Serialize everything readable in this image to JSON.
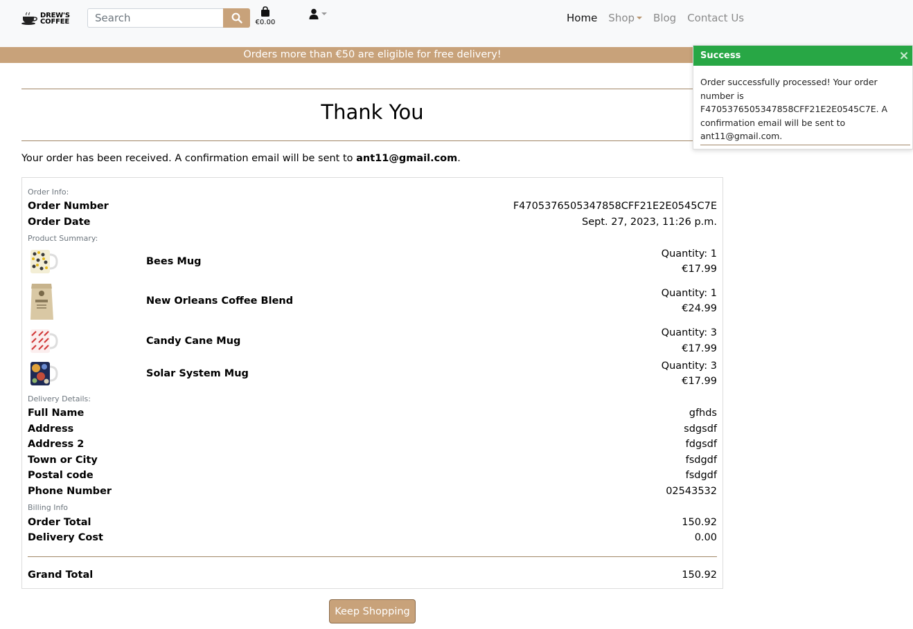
{
  "header": {
    "logo_line1": "DREW'S",
    "logo_line2": "COFFEE",
    "search_placeholder": "Search",
    "bag_total": "€0.00",
    "nav": [
      {
        "label": "Home",
        "active": true
      },
      {
        "label": "Shop",
        "dropdown": true
      },
      {
        "label": "Blog"
      },
      {
        "label": "Contact Us"
      }
    ]
  },
  "banner": {
    "text": "Orders more than €50 are eligible for free delivery!"
  },
  "page": {
    "title": "Thank You",
    "intro_prefix": "Your order has been received. A confirmation email will be sent to ",
    "email": "ant11@gmail.com",
    "intro_suffix": "."
  },
  "order_info": {
    "section_label": "Order Info:",
    "order_number_label": "Order Number",
    "order_number": "F4705376505347858CFF21E2E0545C7E",
    "order_date_label": "Order Date",
    "order_date": "Sept. 27, 2023, 11:26 p.m."
  },
  "products": {
    "section_label": "Product Summary:",
    "items": [
      {
        "name": "Bees Mug",
        "quantity": "Quantity: 1",
        "price": "€17.99"
      },
      {
        "name": "New Orleans Coffee Blend",
        "quantity": "Quantity: 1",
        "price": "€24.99"
      },
      {
        "name": "Candy Cane Mug",
        "quantity": "Quantity: 3",
        "price": "€17.99"
      },
      {
        "name": "Solar System Mug",
        "quantity": "Quantity: 3",
        "price": "€17.99"
      }
    ]
  },
  "delivery": {
    "section_label": "Delivery Details:",
    "rows": [
      {
        "label": "Full Name",
        "value": "gfhds"
      },
      {
        "label": "Address",
        "value": "sdgsdf"
      },
      {
        "label": "Address 2",
        "value": "fdgsdf"
      },
      {
        "label": "Town or City",
        "value": "fsdgdf"
      },
      {
        "label": "Postal code",
        "value": "fsdgdf"
      },
      {
        "label": "Phone Number",
        "value": "02543532"
      }
    ]
  },
  "billing": {
    "section_label": "Billing Info",
    "order_total_label": "Order Total",
    "order_total": "150.92",
    "delivery_cost_label": "Delivery Cost",
    "delivery_cost": "0.00",
    "grand_total_label": "Grand Total",
    "grand_total": "150.92"
  },
  "keep_shopping": "Keep Shopping",
  "toast": {
    "title": "Success",
    "close": "×",
    "message": "Order successfully processed! Your order number is F4705376505347858CFF21E2E0545C7E. A confirmation email will be sent to ant11@gmail.com."
  },
  "colors": {
    "accent": "#c8a27a",
    "success": "#28a745",
    "header_bg": "#f8f9fa"
  }
}
